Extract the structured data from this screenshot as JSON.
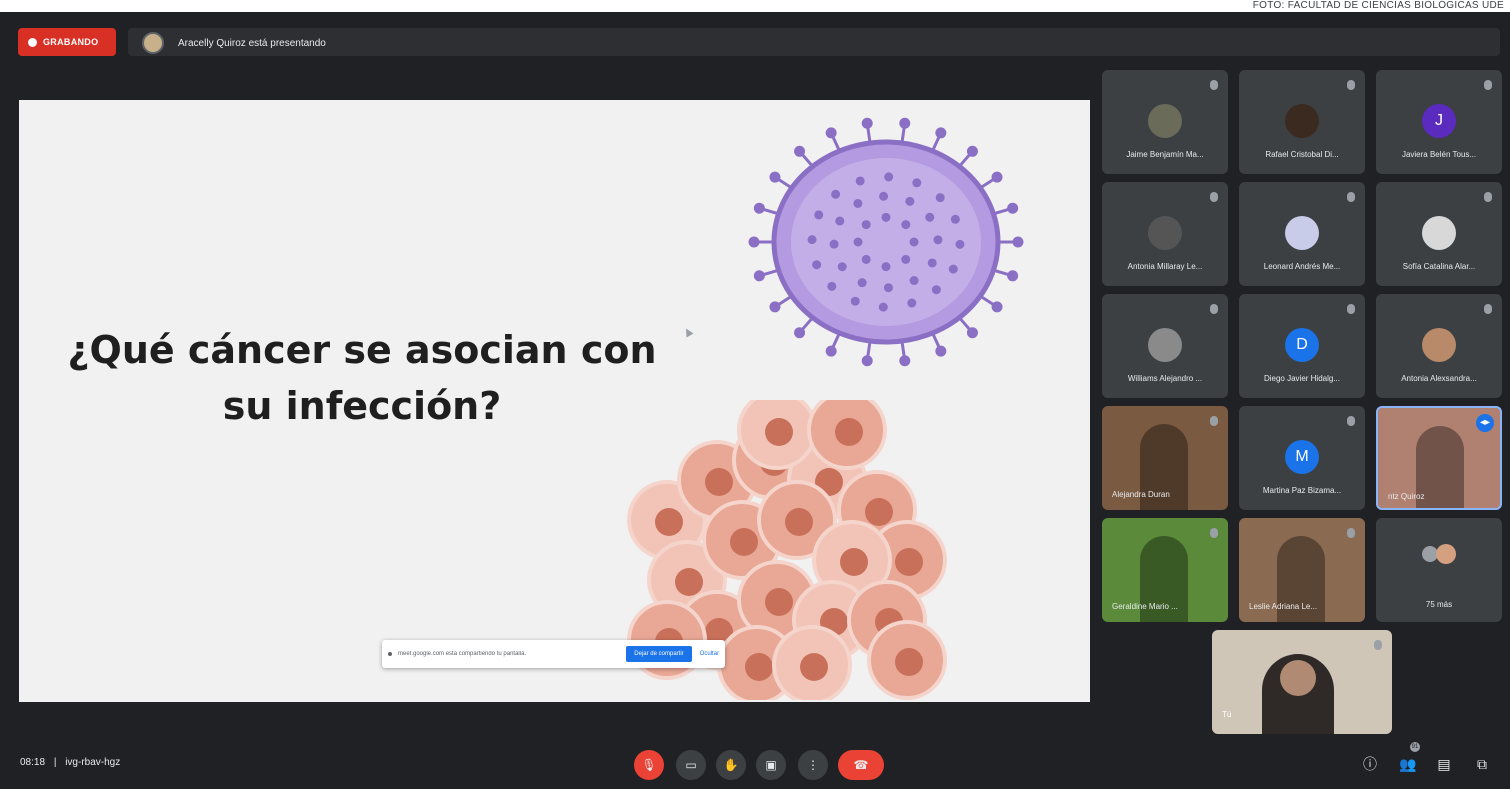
{
  "photo_credit": "FOTO: FACULTAD DE CIENCIAS BIOLÓGICAS UDE",
  "recording": {
    "label": "GRABANDO"
  },
  "presenter": {
    "text": "Aracelly Quiroz está presentando"
  },
  "slide": {
    "line1": "¿Qué cáncer se asocian con",
    "line2": "su infección?"
  },
  "share_banner": {
    "message": "meet.google.com está compartiendo tu pantalla.",
    "stop_label": "Dejar de compartir",
    "hide_label": "Ocultar"
  },
  "participants": [
    {
      "name": "Jaime Benjamín Ma...",
      "avatar": "photo",
      "color": "#6b6b5a"
    },
    {
      "name": "Rafael Cristobal Di...",
      "avatar": "photo",
      "color": "#3a2a20"
    },
    {
      "name": "Javiera Belén Tous...",
      "avatar": "J",
      "color": "#5b2bc0"
    },
    {
      "name": "Antonia Millaray Le...",
      "avatar": "photo",
      "color": "#555555"
    },
    {
      "name": "Leonard Andrés Me...",
      "avatar": "photo",
      "color": "#c9cce8"
    },
    {
      "name": "Sofía Catalina Alar...",
      "avatar": "photo",
      "color": "#d8d8d8"
    },
    {
      "name": "Williams Alejandro ...",
      "avatar": "photo",
      "color": "#8a8a8a"
    },
    {
      "name": "Diego Javier Hidalg...",
      "avatar": "D",
      "color": "#1a73e8"
    },
    {
      "name": "Antonia Alexsandra...",
      "avatar": "photo",
      "color": "#b88a6a"
    },
    {
      "name": "Alejandra Duran",
      "avatar": "video",
      "color": "#7a5a40"
    },
    {
      "name": "Martina Paz Bizama...",
      "avatar": "M",
      "color": "#1a73e8"
    },
    {
      "name": "ntz Quiroz",
      "avatar": "video",
      "color": "#b08070"
    },
    {
      "name": "Geraldine Mario ...",
      "avatar": "video",
      "color": "#5a8a3a"
    },
    {
      "name": "Leslie Adriana Le...",
      "avatar": "video",
      "color": "#8a6a50"
    }
  ],
  "more": {
    "label": "75 más"
  },
  "self_view": {
    "label": "Tú"
  },
  "meeting": {
    "time": "08:18",
    "separator": "|",
    "code": "ivg-rbav-hgz"
  },
  "people_count": "91",
  "colors": {
    "background": "#202124",
    "tile": "#3c4043",
    "hangup": "#ea4335",
    "accent": "#1a73e8"
  }
}
